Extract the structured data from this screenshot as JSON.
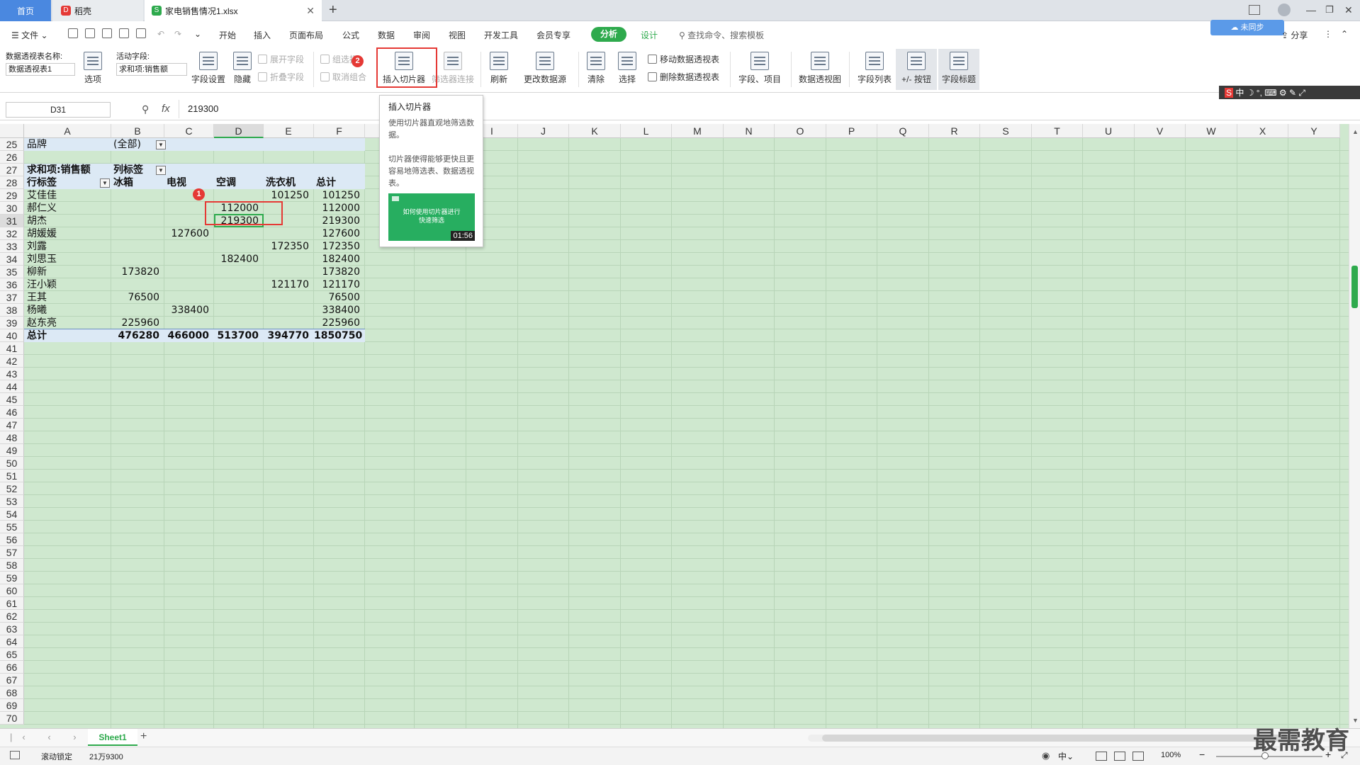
{
  "tabs": {
    "home": "首页",
    "daoke": "稻壳",
    "file": "家电销售情况1.xlsx",
    "add": "+"
  },
  "menu": {
    "file": "文件",
    "items": [
      "开始",
      "插入",
      "页面布局",
      "公式",
      "数据",
      "审阅",
      "视图",
      "开发工具",
      "会员专享"
    ],
    "analyze": "分析",
    "design": "设计",
    "search_placeholder": "查找命令、搜索模板",
    "share": "分享",
    "unsynced": "未同步"
  },
  "ribbon": {
    "pivot_name_label": "数据透视表名称:",
    "pivot_name_value": "数据透视表1",
    "options": "选项",
    "active_field_label": "活动字段:",
    "active_field_value": "求和项:销售额",
    "field_settings": "字段设置",
    "hide": "隐藏",
    "expand_field": "展开字段",
    "collapse_field": "折叠字段",
    "group_selection": "组选择",
    "ungroup": "取消组合",
    "insert_slicer": "插入切片器",
    "filter_connections": "筛选器连接",
    "refresh": "刷新",
    "change_source": "更改数据源",
    "clear": "清除",
    "select": "选择",
    "move_pivot": "移动数据透视表",
    "delete_pivot": "删除数据透视表",
    "fields_items": "字段、项目",
    "pivot_chart": "数据透视图",
    "field_list": "字段列表",
    "plus_minus": "+/- 按钮",
    "field_headers": "字段标题"
  },
  "formula": {
    "cell_ref": "D31",
    "fx": "fx",
    "value": "219300"
  },
  "tooltip": {
    "title": "插入切片器",
    "desc1": "使用切片器直观地筛选数据。",
    "desc2": "切片器使得能够更快且更容易地筛选表、数据透视表。",
    "video_title": "如何使用切片器进行快速筛选",
    "video_time": "01:56"
  },
  "columns": [
    "A",
    "B",
    "C",
    "D",
    "E",
    "F",
    "G",
    "H",
    "I",
    "J",
    "K",
    "L",
    "M",
    "N",
    "O",
    "P",
    "Q",
    "R",
    "S",
    "T",
    "U",
    "V",
    "W",
    "X",
    "Y"
  ],
  "rows": [
    "25",
    "26",
    "27",
    "28",
    "29",
    "30",
    "31",
    "32",
    "33",
    "34",
    "35",
    "36",
    "37",
    "38",
    "39",
    "40",
    "41",
    "42",
    "43",
    "44",
    "45",
    "46",
    "47",
    "48",
    "49",
    "50",
    "51",
    "52",
    "53",
    "54",
    "55",
    "56",
    "57",
    "58",
    "59",
    "60",
    "61",
    "62",
    "63",
    "64",
    "65",
    "66",
    "67",
    "68",
    "69",
    "70"
  ],
  "pivot": {
    "filter_label": "品牌",
    "filter_value": "(全部)",
    "sum_label": "求和项:销售额",
    "col_label": "列标签",
    "row_label": "行标签",
    "col_headers": [
      "冰箱",
      "电视",
      "空调",
      "洗衣机",
      "总计"
    ],
    "data": [
      {
        "name": "艾佳佳",
        "v": [
          "",
          "",
          "",
          "101250",
          "101250"
        ]
      },
      {
        "name": "郝仁义",
        "v": [
          "",
          "",
          "112000",
          "",
          "112000"
        ]
      },
      {
        "name": "胡杰",
        "v": [
          "",
          "",
          "219300",
          "",
          "219300"
        ]
      },
      {
        "name": "胡媛媛",
        "v": [
          "",
          "127600",
          "",
          "",
          "127600"
        ]
      },
      {
        "name": "刘露",
        "v": [
          "",
          "",
          "",
          "172350",
          "172350"
        ]
      },
      {
        "name": "刘思玉",
        "v": [
          "",
          "",
          "182400",
          "",
          "182400"
        ]
      },
      {
        "name": "柳新",
        "v": [
          "173820",
          "",
          "",
          "",
          "173820"
        ]
      },
      {
        "name": "汪小颖",
        "v": [
          "",
          "",
          "",
          "121170",
          "121170"
        ]
      },
      {
        "name": "王其",
        "v": [
          "76500",
          "",
          "",
          "",
          "76500"
        ]
      },
      {
        "name": "杨曦",
        "v": [
          "",
          "338400",
          "",
          "",
          "338400"
        ]
      },
      {
        "name": "赵东亮",
        "v": [
          "225960",
          "",
          "",
          "",
          "225960"
        ]
      }
    ],
    "total_label": "总计",
    "totals": [
      "476280",
      "466000",
      "513700",
      "394770",
      "1850750"
    ]
  },
  "badges": [
    "1",
    "2"
  ],
  "sheet_tab": "Sheet1",
  "status": {
    "scroll_lock": "滚动锁定",
    "value": "21万9300",
    "zoom": "100%",
    "ime": "中"
  },
  "watermark": "最需教育",
  "colors": {
    "accent": "#4a88e0",
    "analyze": "#2eaa4d",
    "sheet_bg": "#cfe8cf",
    "highlight": "#e53935"
  }
}
